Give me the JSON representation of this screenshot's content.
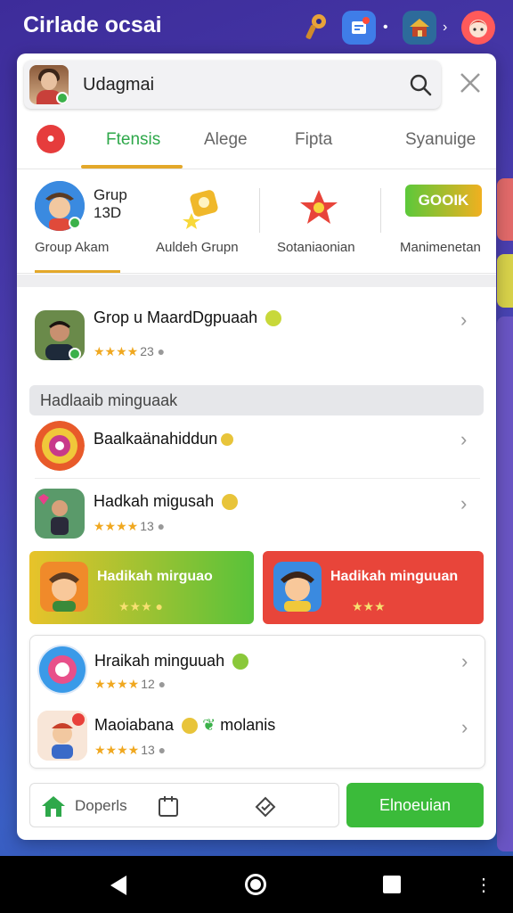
{
  "topbar": {
    "app_title": "Cirlade ocsai"
  },
  "search": {
    "value": "Udagmai"
  },
  "tabs": [
    {
      "label": "Ftensis",
      "active": true
    },
    {
      "label": "Alege",
      "active": false
    },
    {
      "label": "Fipta",
      "active": false
    },
    {
      "label": "Syanuige",
      "active": false
    }
  ],
  "categories": {
    "group_name": "Grup 13D",
    "items": [
      {
        "label": "Group Akam"
      },
      {
        "label": "Auldeh Grupn"
      },
      {
        "label": "Sotaniaonian"
      },
      {
        "label": "Manimenetan"
      }
    ],
    "promo_button": "GOOIK"
  },
  "list_top": {
    "title": "Grop u MaardDgpuaah",
    "rating": "23"
  },
  "section": {
    "heading": "Hadlaaib minguaak"
  },
  "list": [
    {
      "title": "Baalkaänahiddun",
      "rating": ""
    },
    {
      "title": "Hadkah migusah",
      "rating": "13"
    }
  ],
  "banners": [
    {
      "title": "Hadikah mirguao",
      "color": "#58c23a"
    },
    {
      "title": "Hadikah minguuan",
      "color": "#e8453a"
    }
  ],
  "card_list": [
    {
      "title": "Hraikah minguuah",
      "rating": "12"
    },
    {
      "title": "Maoiabana",
      "title_suffix": "molanis",
      "rating": "13"
    }
  ],
  "bottom": {
    "left_label": "Doperls",
    "action_button": "Elnoeuian"
  },
  "colors": {
    "accent_green": "#3bbb3a",
    "tab_underline": "#e3a82a",
    "star": "#f0a820"
  }
}
